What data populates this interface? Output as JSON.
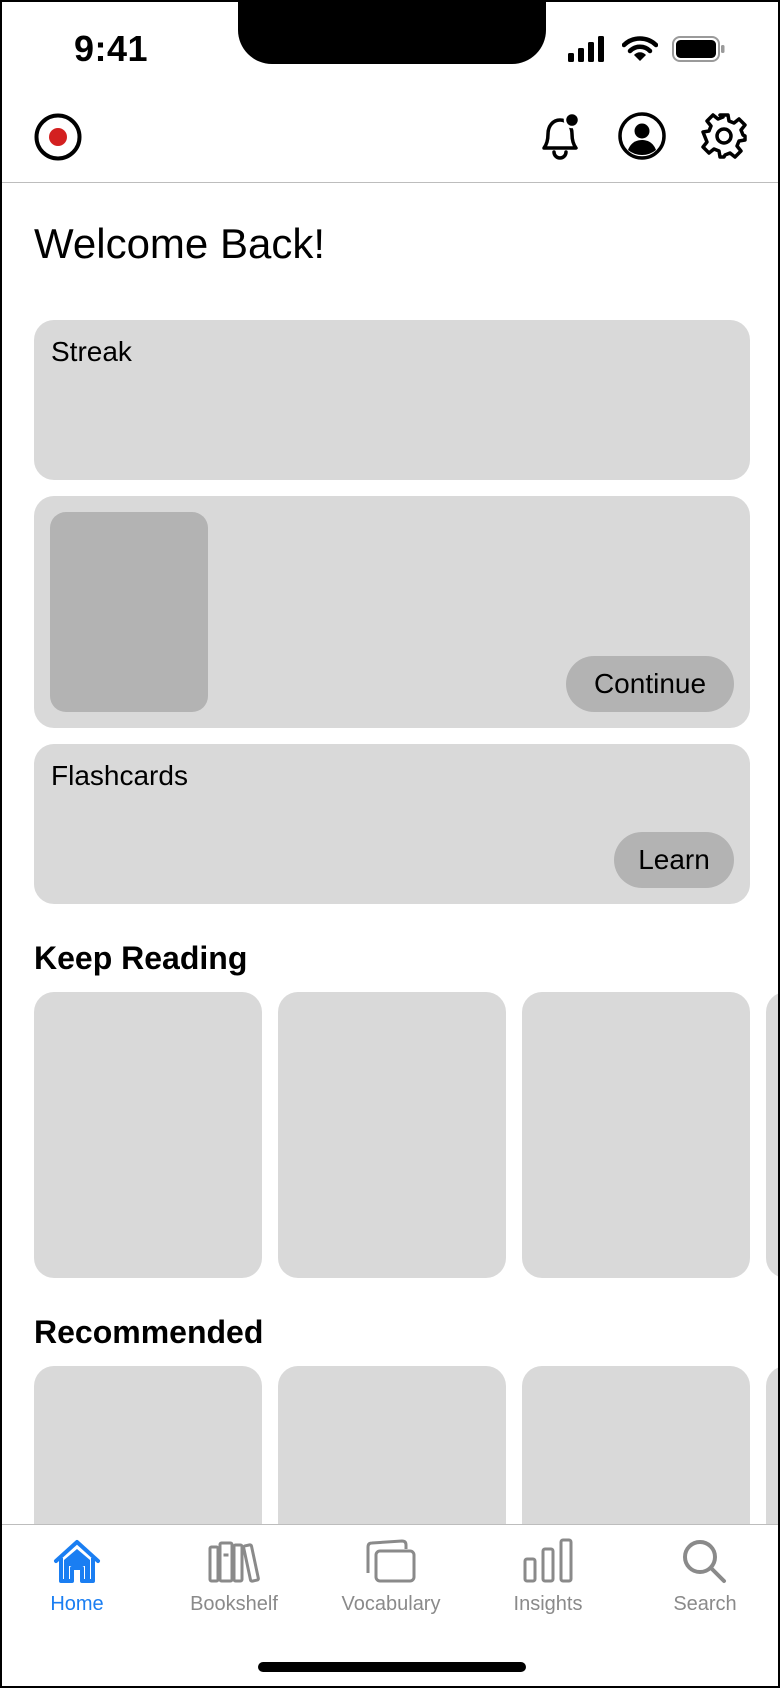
{
  "status_bar": {
    "time": "9:41",
    "icons": [
      "cellular-signal-icon",
      "wifi-icon",
      "battery-icon"
    ]
  },
  "header": {
    "left_icon": "record-icon",
    "actions": [
      "notification-bell-icon",
      "profile-icon",
      "settings-gear-icon"
    ],
    "record_color": "#d32020"
  },
  "main": {
    "welcome": "Welcome Back!",
    "streak_card": {
      "title": "Streak"
    },
    "book_card": {
      "button_label": "Continue"
    },
    "flashcards_card": {
      "title": "Flashcards",
      "button_label": "Learn"
    },
    "keep_reading": {
      "title": "Keep Reading"
    },
    "recommended": {
      "title": "Recommended"
    }
  },
  "tab_bar": {
    "active_color": "#1a7ef2",
    "inactive_color": "#8a8a8a",
    "items": [
      {
        "label": "Home",
        "icon": "home-icon",
        "active": true
      },
      {
        "label": "Bookshelf",
        "icon": "bookshelf-icon",
        "active": false
      },
      {
        "label": "Vocabulary",
        "icon": "vocabulary-cards-icon",
        "active": false
      },
      {
        "label": "Insights",
        "icon": "insights-bar-chart-icon",
        "active": false
      },
      {
        "label": "Search",
        "icon": "search-icon",
        "active": false
      }
    ]
  }
}
